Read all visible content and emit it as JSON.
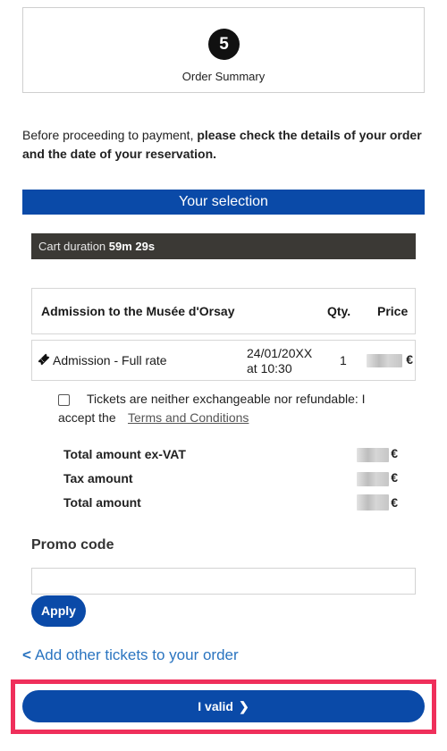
{
  "stepper": {
    "step_number": "5",
    "step_label": "Order Summary"
  },
  "intro": {
    "text_plain": "Before proceeding to payment, ",
    "text_bold": "please check the details of your order and the date of your reservation."
  },
  "selection": {
    "title": "Your selection"
  },
  "cart": {
    "label": "Cart duration ",
    "duration": "59m 29s"
  },
  "order_table": {
    "headers": {
      "product": "Admission to the Musée d'Orsay",
      "qty": "Qty.",
      "price": "Price"
    },
    "rows": [
      {
        "icon": "ticket-icon",
        "name": "Admission - Full rate",
        "date": "24/01/20XX",
        "time": "at 10:30",
        "qty": "1",
        "currency": "€"
      }
    ]
  },
  "terms": {
    "line1": "Tickets are neither exchangeable nor refundable: I",
    "line2": "accept the",
    "link": "Terms and Conditions"
  },
  "totals": {
    "ex_vat_label": "Total amount ex-VAT",
    "tax_label": "Tax amount",
    "total_label": "Total amount",
    "currency": "€"
  },
  "promo": {
    "title": "Promo code",
    "placeholder": "",
    "value": "",
    "apply_label": "Apply"
  },
  "add_other": {
    "chevron": "<",
    "label": "Add other tickets to your order"
  },
  "confirm": {
    "label": "I valid",
    "chevron": "❯"
  },
  "colors": {
    "primary_blue": "#0a4aa8",
    "cart_bar": "#3b3935",
    "link_blue": "#2a74c0",
    "highlight": "#ef2f5b"
  }
}
